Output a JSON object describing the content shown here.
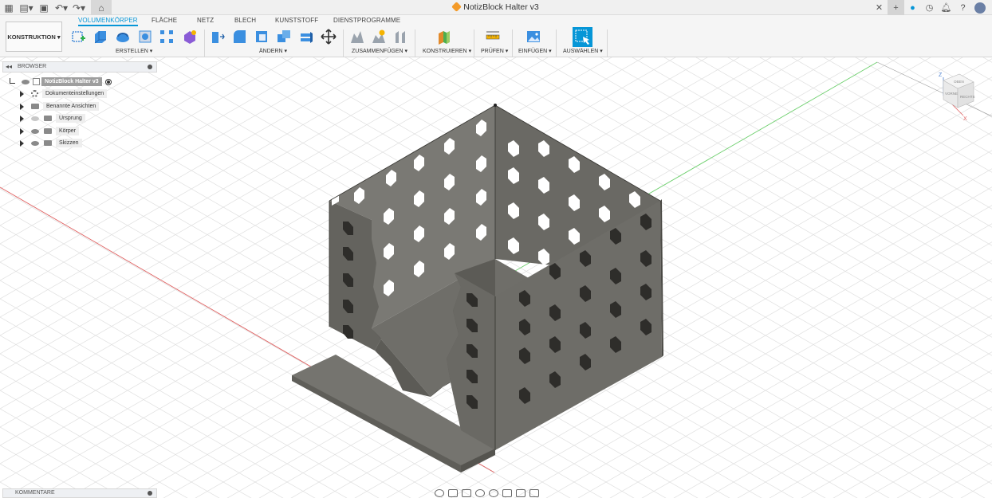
{
  "window": {
    "title": "NotizBlock Halter v3"
  },
  "ribbon": {
    "tabs": [
      "VOLUMENKÖRPER",
      "FLÄCHE",
      "NETZ",
      "BLECH",
      "KUNSTSTOFF",
      "DIENSTPROGRAMME"
    ],
    "workspace_label": "KONSTRUKTION",
    "groups": [
      "ERSTELLEN",
      "ÄNDERN",
      "ZUSAMMENFÜGEN",
      "KONSTRUIEREN",
      "PRÜFEN",
      "EINFÜGEN",
      "AUSWÄHLEN"
    ]
  },
  "browser": {
    "title": "BROWSER",
    "root": "NotizBlock Halter v3",
    "items": [
      {
        "label": "Dokumenteinstellungen",
        "icon": "gear-icon"
      },
      {
        "label": "Benannte Ansichten",
        "icon": "folder-icon"
      },
      {
        "label": "Ursprung",
        "icon": "folder-icon"
      },
      {
        "label": "Körper",
        "icon": "folder-icon"
      },
      {
        "label": "Skizzen",
        "icon": "folder-icon"
      }
    ]
  },
  "comments": {
    "title": "KOMMENTARE"
  },
  "viewcube": {
    "top": "OBEN",
    "front": "VORNE",
    "right": "RECHTS",
    "axis_z": "Z",
    "axis_x": "X"
  },
  "colors": {
    "accent": "#0696d7",
    "model": "#6b6b66",
    "grid_x": "#e06060",
    "grid_y": "#6ccf6c"
  }
}
